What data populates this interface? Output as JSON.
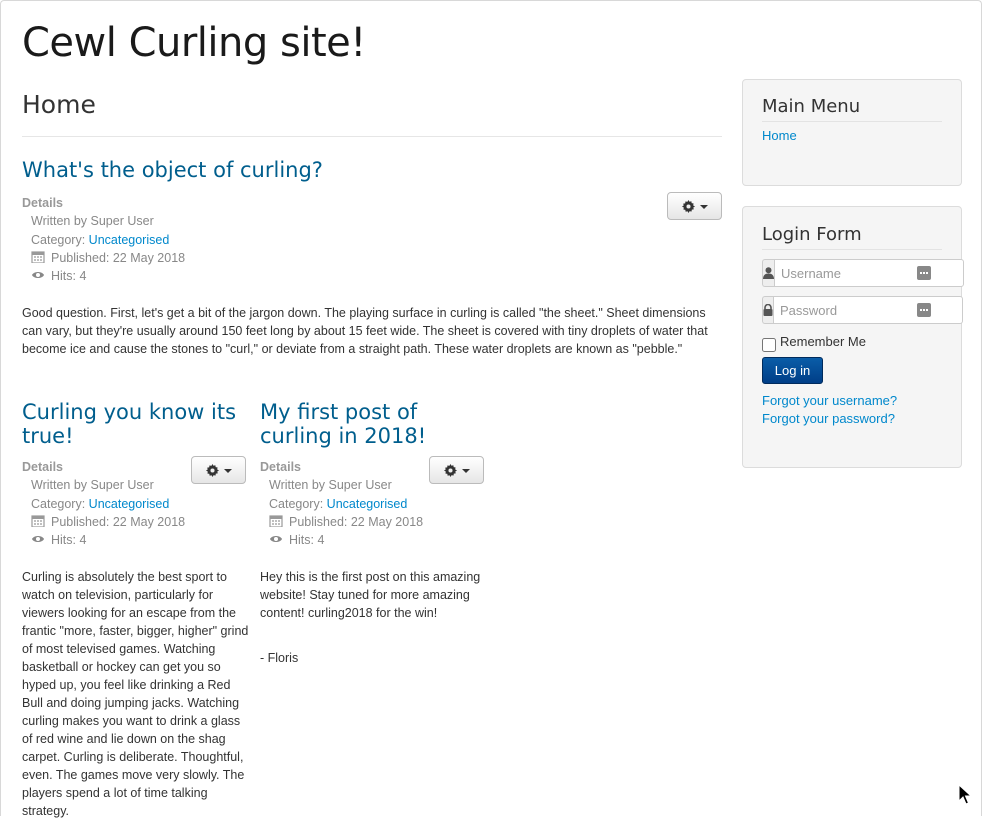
{
  "site": {
    "title": "Cewl Curling site!"
  },
  "page": {
    "heading": "Home"
  },
  "articles": [
    {
      "title": "What's the object of curling?",
      "details_label": "Details",
      "written_by": "Written by Super User",
      "category_label": "Category: ",
      "category": "Uncategorised",
      "published": "Published: 22 May 2018",
      "hits": "Hits: 4",
      "body": "Good question. First, let's get a bit of the jargon down. The playing surface in curling is called \"the sheet.\" Sheet dimensions can vary, but they're usually around 150 feet long by about 15 feet wide. The sheet is covered with tiny droplets of water that become ice and cause the stones to \"curl,\" or deviate from a straight path. These water droplets are known as \"pebble.\""
    },
    {
      "title": "Curling you know its true!",
      "details_label": "Details",
      "written_by": "Written by Super User",
      "category_label": "Category: ",
      "category": "Uncategorised",
      "published": "Published: 22 May 2018",
      "hits": "Hits: 4",
      "body": "Curling is absolutely the best sport to watch on television, particularly for viewers looking for an escape from the frantic \"more, faster, bigger, higher\" grind of most televised games. Watching basketball or hockey can get you so hyped up, you feel like drinking a Red Bull and doing jumping jacks. Watching curling makes you want to drink a glass of red wine and lie down on the shag carpet. Curling is deliberate. Thoughtful, even. The games move very slowly. The players spend a lot of time talking strategy."
    },
    {
      "title": "My first post of curling in 2018!",
      "details_label": "Details",
      "written_by": "Written by Super User",
      "category_label": "Category: ",
      "category": "Uncategorised",
      "published": "Published: 22 May 2018",
      "hits": "Hits: 4",
      "body": "Hey this is the first post on this amazing website! Stay tuned for more amazing content! curling2018 for the win!",
      "signature": "- Floris"
    }
  ],
  "sidebar": {
    "main_menu": {
      "title": "Main Menu",
      "items": [
        {
          "label": "Home"
        }
      ]
    },
    "login": {
      "title": "Login Form",
      "username_placeholder": "Username",
      "password_placeholder": "Password",
      "remember_label": "Remember Me",
      "login_button": "Log in",
      "forgot_username": "Forgot your username?",
      "forgot_password": "Forgot your password?"
    }
  },
  "colors": {
    "link": "#0088cc",
    "title": "#005e8d",
    "login_button": "#0a5da8"
  }
}
